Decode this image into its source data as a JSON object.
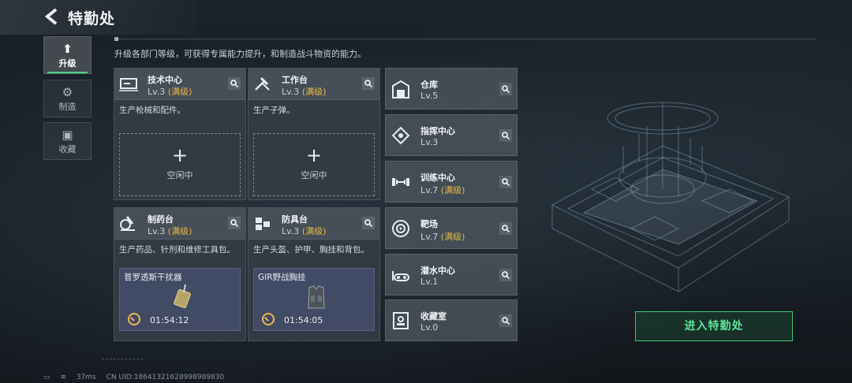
{
  "header": {
    "title": "特勤处"
  },
  "description": "升级各部门等级，可获得专属能力提升，和制造战斗物资的能力。",
  "tabs": [
    {
      "label": "升级",
      "icon": "upgrade-icon",
      "active": true
    },
    {
      "label": "制造",
      "icon": "gears-icon",
      "active": false
    },
    {
      "label": "收藏",
      "icon": "collection-icon",
      "active": false
    }
  ],
  "cards": [
    {
      "name": "技术中心",
      "level": "Lv.3",
      "max": "(满级)",
      "icon": "tech-center-icon",
      "desc": "生产枪械和配件。",
      "slot_label": "空闲中"
    },
    {
      "name": "工作台",
      "level": "Lv.3",
      "max": "(满级)",
      "icon": "workbench-icon",
      "desc": "生产子弹。",
      "slot_label": "空闲中"
    },
    {
      "name": "制药台",
      "level": "Lv.3",
      "max": "(满级)",
      "icon": "microscope-icon",
      "desc": "生产药品、针剂和维修工具包。",
      "item": "普罗透斯干扰器",
      "timer": "01:54:12"
    },
    {
      "name": "防具台",
      "level": "Lv.3",
      "max": "(满级)",
      "icon": "armor-bench-icon",
      "desc": "生产头盔、护甲、胸挂和背包。",
      "item": "GIR野战胸挂",
      "timer": "01:54:05"
    }
  ],
  "rows": [
    {
      "name": "仓库",
      "level": "Lv.5",
      "max": "",
      "icon": "warehouse-icon"
    },
    {
      "name": "指挥中心",
      "level": "Lv.3",
      "max": "",
      "icon": "command-chip-icon"
    },
    {
      "name": "训练中心",
      "level": "Lv.7",
      "max": "(满级)",
      "icon": "dumbbell-icon"
    },
    {
      "name": "靶场",
      "level": "Lv.7",
      "max": "(满级)",
      "icon": "target-icon"
    },
    {
      "name": "潜水中心",
      "level": "Lv.1",
      "max": "",
      "icon": "diving-mask-icon"
    },
    {
      "name": "收藏室",
      "level": "Lv.0",
      "max": "",
      "icon": "collection-room-icon"
    }
  ],
  "enter_button": "进入特勤处",
  "status": {
    "ping": "37ms",
    "uid": "CN UID:18641321628998989830"
  },
  "colors": {
    "accent_green": "#4fd08a",
    "max_gold": "#e6b84b",
    "panel": "#4a525a"
  }
}
